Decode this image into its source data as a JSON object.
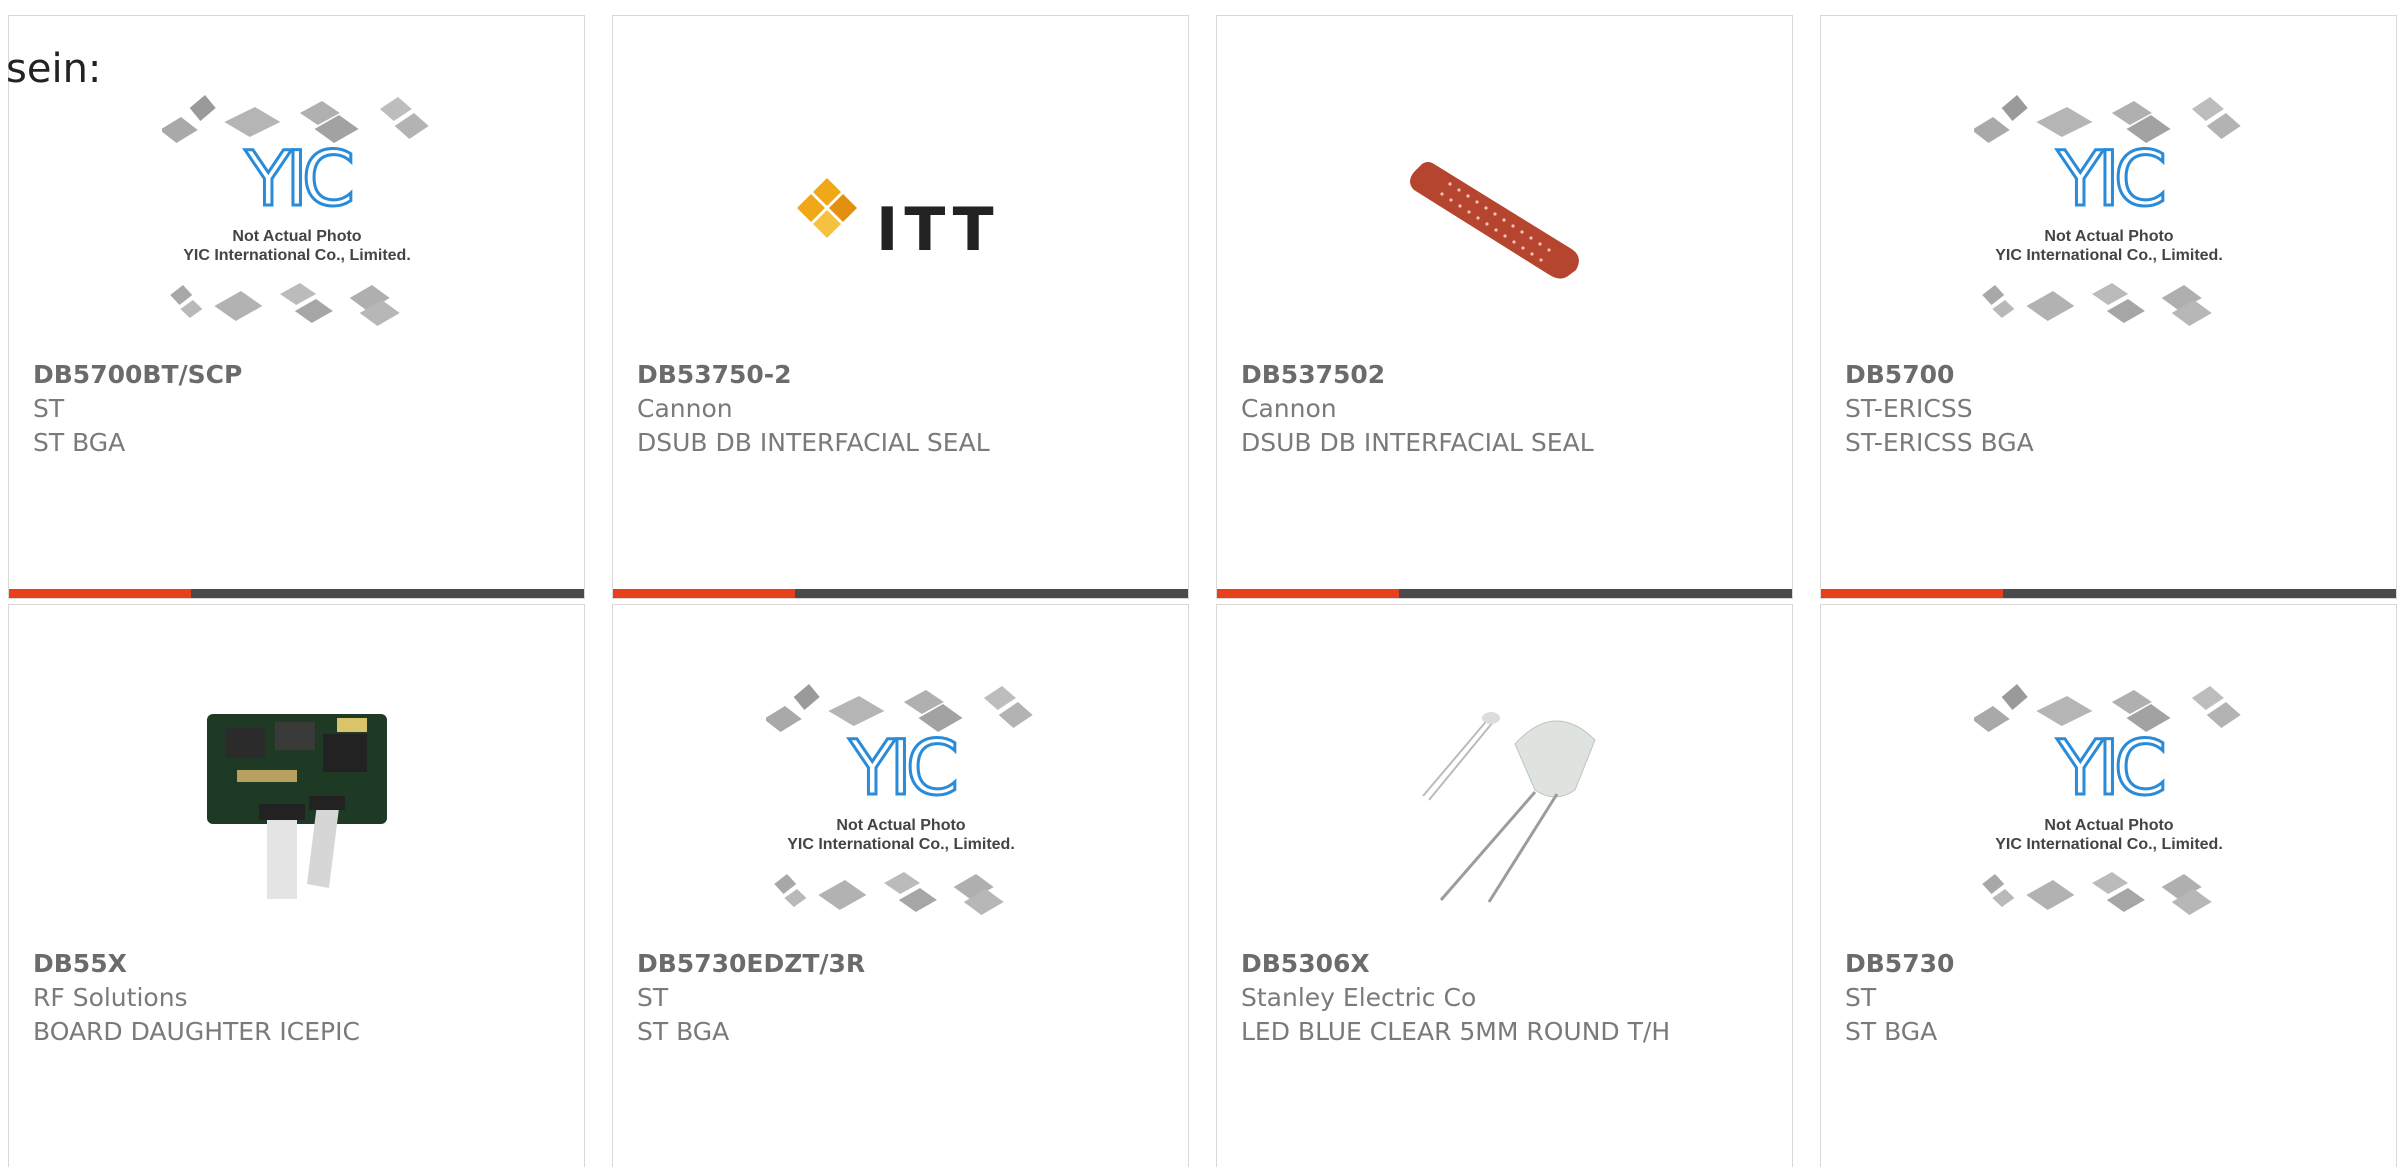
{
  "overlay_text": "sein:",
  "colors": {
    "accent": "#e8401c",
    "bar": "#4a4a4a",
    "border": "#d8d8d8",
    "text": "#7a7a7a"
  },
  "placeholder_image": {
    "line1": "Not Actual Photo",
    "line2": "YIC International Co., Limited.",
    "logo": "YIC"
  },
  "itt_logo_text": "ITT",
  "products": [
    {
      "part_number": "DB5700BT/SCP",
      "manufacturer": "ST",
      "description": "ST BGA",
      "image": "yic-placeholder",
      "highlight_bar": true
    },
    {
      "part_number": "DB53750-2",
      "manufacturer": "Cannon",
      "description": "DSUB DB INTERFACIAL SEAL",
      "image": "itt-logo",
      "highlight_bar": true
    },
    {
      "part_number": "DB537502",
      "manufacturer": "Cannon",
      "description": "DSUB DB INTERFACIAL SEAL",
      "image": "seal-strip",
      "highlight_bar": true
    },
    {
      "part_number": "DB5700",
      "manufacturer": "ST-ERICSS",
      "description": "ST-ERICSS BGA",
      "image": "yic-placeholder",
      "highlight_bar": true
    },
    {
      "part_number": "DB55X",
      "manufacturer": "RF Solutions",
      "description": "BOARD DAUGHTER ICEPIC",
      "image": "pcb-board",
      "highlight_bar": false
    },
    {
      "part_number": "DB5730EDZT/3R",
      "manufacturer": "ST",
      "description": "ST BGA",
      "image": "yic-placeholder",
      "highlight_bar": false
    },
    {
      "part_number": "DB5306X",
      "manufacturer": "Stanley Electric Co",
      "description": "LED BLUE CLEAR 5MM ROUND T/H",
      "image": "led",
      "highlight_bar": false
    },
    {
      "part_number": "DB5730",
      "manufacturer": "ST",
      "description": "ST BGA",
      "image": "yic-placeholder",
      "highlight_bar": false
    }
  ]
}
